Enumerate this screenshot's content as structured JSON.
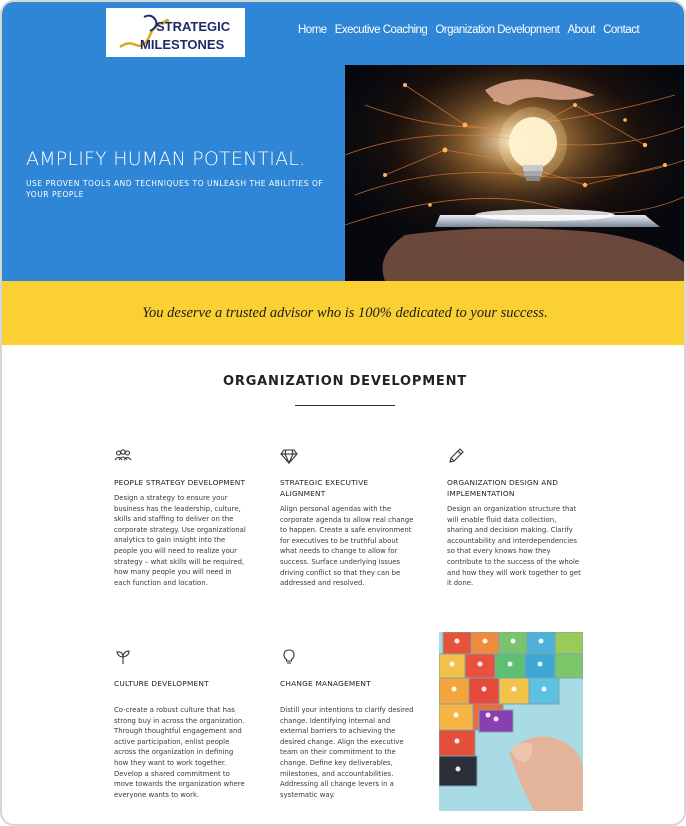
{
  "brand": {
    "logo_line1": "STRATEGIC",
    "logo_line2": "MILESTONES",
    "logo_alt": "Strategic Milestones logo",
    "colors": {
      "blue": "#2f86d6",
      "yellow": "#fad032",
      "navy": "#1f2a6b",
      "gold": "#d9a81e"
    }
  },
  "nav": {
    "items": [
      {
        "label": "Home"
      },
      {
        "label": "Executive Coaching"
      },
      {
        "label": "Organization Development"
      },
      {
        "label": "About"
      },
      {
        "label": "Contact"
      }
    ]
  },
  "hero": {
    "title": "AMPLIFY HUMAN POTENTIAL.",
    "subtitle": "USE PROVEN TOOLS AND TECHNIQUES TO UNLEASH THE ABILITIES OF YOUR PEOPLE",
    "image": "hands-holding-lightbulb-over-tablet"
  },
  "banner": {
    "text": "You deserve a trusted advisor who is 100% dedicated to your success."
  },
  "section": {
    "title": "ORGANIZATION DEVELOPMENT",
    "cards": [
      {
        "icon": "people-group-icon",
        "title": "PEOPLE STRATEGY DEVELOPMENT",
        "body": "Design a strategy to ensure your business has the leadership, culture, skills and staffing to deliver on the corporate strategy. Use organizational analytics to gain insight into the people you will need to realize your strategy – what skills will be required, how many people you will need in each function and location."
      },
      {
        "icon": "diamond-icon",
        "title": "STRATEGIC EXECUTIVE ALIGNMENT",
        "body": "Align personal agendas with the corporate agenda to allow real change to happen. Create a safe environment for executives to be truthful about what needs to change to allow for success. Surface underlying issues driving conflict so that they can be addressed and resolved."
      },
      {
        "icon": "pencil-icon",
        "title": "ORGANIZATION DESIGN AND IMPLEMENTATION",
        "body": "Design an organization structure that will enable fluid data collection, sharing and decision making. Clarify accountability and interdependencies so that every knows how they contribute to the success of the whole and how they will work together to get it done."
      },
      {
        "icon": "sprout-icon",
        "title": "CULTURE DEVELOPMENT",
        "body": "Co-create a robust culture that has strong buy in across the organization. Through thoughtful engagement and active participation, enlist people across the organization in defining how they want to work together. Develop a shared commitment to move towards the organization where everyone wants to work."
      },
      {
        "icon": "lightbulb-icon",
        "title": "CHANGE MANAGEMENT",
        "body": "Distill your intentions to clarify desired change. Identifying internal and external barriers to achieving the desired change. Align the executive team on their commitment to the change. Define key deliverables, milestones, and accountabilities. Addressing all change levers in a systematic way."
      }
    ],
    "side_image": "colorful-puzzle-pieces-with-people-icons"
  }
}
